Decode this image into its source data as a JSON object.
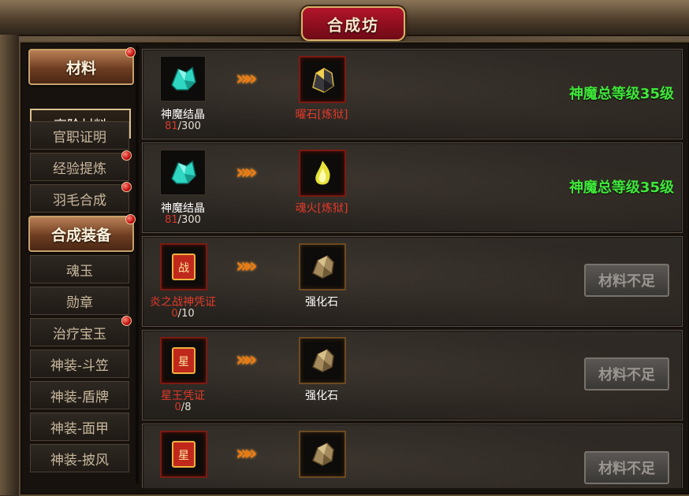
{
  "window": {
    "title": "合成坊"
  },
  "sidebar": {
    "categories": [
      {
        "label": "材料",
        "has_dot": true
      },
      {
        "label": "合成装备",
        "has_dot": true
      }
    ],
    "subs": [
      {
        "label": "高阶材料",
        "active": true
      },
      {
        "label": "官职证明"
      },
      {
        "label": "经验提炼",
        "has_dot": true
      },
      {
        "label": "羽毛合成",
        "has_dot": true
      },
      {
        "label": "魂玉"
      },
      {
        "label": "勋章"
      },
      {
        "label": "治疗宝玉",
        "has_dot": true
      },
      {
        "label": "神装-斗笠"
      },
      {
        "label": "神装-盾牌"
      },
      {
        "label": "神装-面甲"
      },
      {
        "label": "神装-披风"
      }
    ]
  },
  "recipes": [
    {
      "input": {
        "name": "神魔结晶",
        "have": "81",
        "need": "300",
        "icon": "crystal-icon"
      },
      "output": {
        "name": "曜石[炼狱]",
        "icon": "dark-stone-icon"
      },
      "requirement": "神魔总等级35级"
    },
    {
      "input": {
        "name": "神魔结晶",
        "have": "81",
        "need": "300",
        "icon": "crystal-icon"
      },
      "output": {
        "name": "魂火[炼狱]",
        "icon": "soul-fire-icon"
      },
      "requirement": "神魔总等级35级"
    },
    {
      "input": {
        "name": "炎之战神凭证",
        "have": "0",
        "need": "10",
        "icon": "war-scroll-icon",
        "glyph": "战"
      },
      "output": {
        "name": "强化石",
        "icon": "ore-stone-icon"
      },
      "button": "材料不足"
    },
    {
      "input": {
        "name": "星王凭证",
        "have": "0",
        "need": "8",
        "icon": "star-scroll-icon",
        "glyph": "星"
      },
      "output": {
        "name": "强化石",
        "icon": "ore-stone-icon"
      },
      "button": "材料不足"
    },
    {
      "input": {
        "name": "",
        "icon": "star-scroll-icon",
        "glyph": "星"
      },
      "output": {
        "name": "",
        "icon": "ore-stone-icon"
      },
      "button": "材料不足"
    }
  ],
  "arrow_glyph": "»»",
  "count_sep": "/",
  "colors": {
    "accent_green": "#3fe83a",
    "need_red": "#e33a2a",
    "title_red": "#b3142a"
  }
}
